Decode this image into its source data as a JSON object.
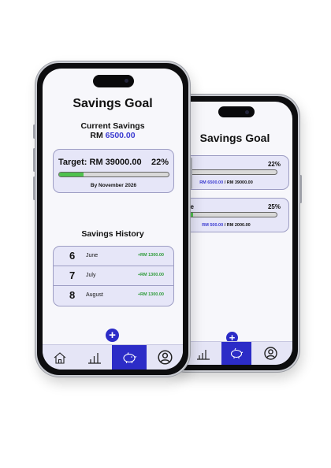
{
  "app_title": "Savings Goal",
  "current_savings": {
    "label": "Current Savings",
    "amount": "RM 6500.00",
    "currency": "RM",
    "value": "6500.00"
  },
  "main_goal": {
    "target_text": "Target: RM 39000.00",
    "percent_text": "22%",
    "progress": 0.22,
    "deadline": "By November 2026"
  },
  "history": {
    "title": "Savings History",
    "rows": [
      {
        "day": "6",
        "month": "June",
        "amount": "+RM 1300.00"
      },
      {
        "day": "7",
        "month": "July",
        "amount": "+RM 1300.00"
      },
      {
        "day": "8",
        "month": "August",
        "amount": "+RM 1300.00"
      }
    ]
  },
  "goals": [
    {
      "name_partial": "r",
      "percent_text": "22%",
      "progress": 0.22,
      "saved": "RM 6500.00",
      "separator": " / ",
      "target": "RM 39000.00"
    },
    {
      "name_partial": "w Phone",
      "percent_text": "25%",
      "progress": 0.25,
      "saved": "RM 500.00",
      "separator": " / ",
      "target": "RM 2000.00"
    }
  ],
  "add_button": {
    "label": "+"
  },
  "nav": {
    "items": [
      {
        "id": "home",
        "icon": "home-icon"
      },
      {
        "id": "stats",
        "icon": "bar-chart-icon"
      },
      {
        "id": "savings",
        "icon": "piggy-bank-icon",
        "active": true
      },
      {
        "id": "profile",
        "icon": "user-circle-icon"
      }
    ]
  },
  "colors": {
    "accent": "#2c2cc7",
    "accent_text": "#3b3bd1",
    "progress_fill": "#4fc14e",
    "card_bg": "#e6e6f8",
    "positive": "#2e9b3a"
  }
}
